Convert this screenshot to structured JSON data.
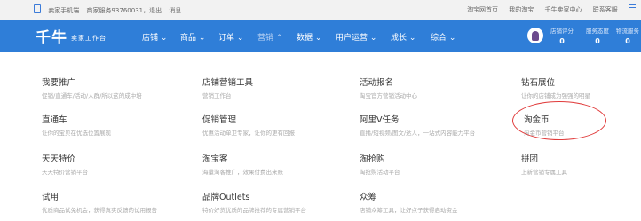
{
  "topbar": {
    "left": [
      "卖家手机端",
      "商家服务93760031，退出",
      "消息"
    ],
    "right": [
      "淘宝网首页",
      "我的淘宝",
      "千牛卖家中心",
      "联系客服"
    ]
  },
  "nav": {
    "logo": "千牛",
    "logo_sub": "卖家工作台",
    "items": [
      "店铺",
      "商品",
      "订单",
      "营销",
      "数据",
      "用户运营",
      "成长",
      "综合"
    ],
    "stats": [
      {
        "label": "店铺评分",
        "value": "0"
      },
      {
        "label": "服务态度",
        "value": "0"
      },
      {
        "label": "物流服务",
        "value": "0"
      }
    ]
  },
  "entries": [
    {
      "title": "我要推广",
      "desc": "促销/直通车/活动/人群/所以这的成中培"
    },
    {
      "title": "店铺营销工具",
      "desc": "营销工作台"
    },
    {
      "title": "活动报名",
      "desc": "淘宝官方营销活动中心"
    },
    {
      "title": "钻石展位",
      "desc": "让你的店铺成为强强的明星"
    },
    {
      "title": "直通车",
      "desc": "让你的宝贝在优选位置展现"
    },
    {
      "title": "促销管理",
      "desc": "优惠活动单卫专家，让你的更有回报"
    },
    {
      "title": "阿里V任务",
      "desc": "直播/短视频/图文/达人，一站式内容能力平台"
    },
    {
      "title": "淘金币",
      "desc": "淘金币营销平台"
    },
    {
      "title": "天天特价",
      "desc": "天天特价营销平台"
    },
    {
      "title": "淘宝客",
      "desc": "海量淘客推广，效果付费出来账"
    },
    {
      "title": "淘抢购",
      "desc": "淘抢购活动平台"
    },
    {
      "title": "拼团",
      "desc": "上新营销专属工具"
    },
    {
      "title": "试用",
      "desc": "优质商品试免机会，获得真实反馈的试用报告"
    },
    {
      "title": "品牌Outlets",
      "desc": "特价好货优质的品牌推荐的专属营销平台"
    },
    {
      "title": "众筹",
      "desc": "店铺众筹工具，让好点子获得启动资金"
    }
  ]
}
